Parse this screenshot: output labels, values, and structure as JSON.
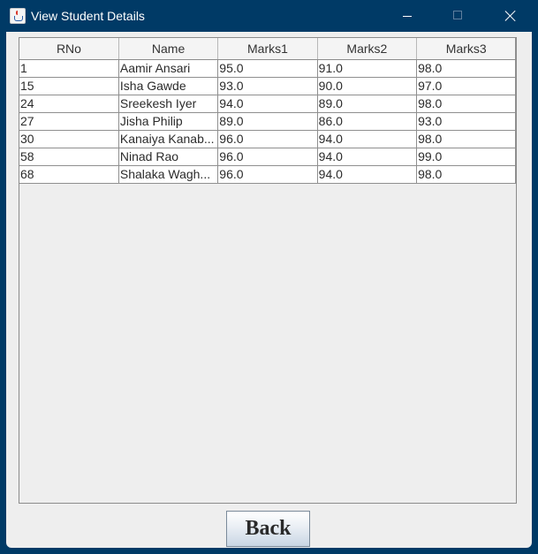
{
  "window": {
    "title": "View Student Details",
    "icon": "java-cup-icon",
    "controls": [
      "minimize-icon",
      "maximize-icon",
      "close-icon"
    ]
  },
  "table": {
    "columns": [
      "RNo",
      "Name",
      "Marks1",
      "Marks2",
      "Marks3"
    ],
    "rows": [
      [
        "1",
        "Aamir Ansari",
        "95.0",
        "91.0",
        "98.0"
      ],
      [
        "15",
        "Isha Gawde",
        "93.0",
        "90.0",
        "97.0"
      ],
      [
        "24",
        "Sreekesh Iyer",
        "94.0",
        "89.0",
        "98.0"
      ],
      [
        "27",
        "Jisha Philip",
        "89.0",
        "86.0",
        "93.0"
      ],
      [
        "30",
        "Kanaiya Kanab...",
        "96.0",
        "94.0",
        "98.0"
      ],
      [
        "58",
        "Ninad Rao",
        "96.0",
        "94.0",
        "99.0"
      ],
      [
        "68",
        "Shalaka Wagh...",
        "96.0",
        "94.0",
        "98.0"
      ]
    ]
  },
  "buttons": {
    "back_label": "Back"
  },
  "colors": {
    "titlebar": "#003a66",
    "panel": "#eeeeee",
    "grid_line": "#8f8f8f"
  }
}
